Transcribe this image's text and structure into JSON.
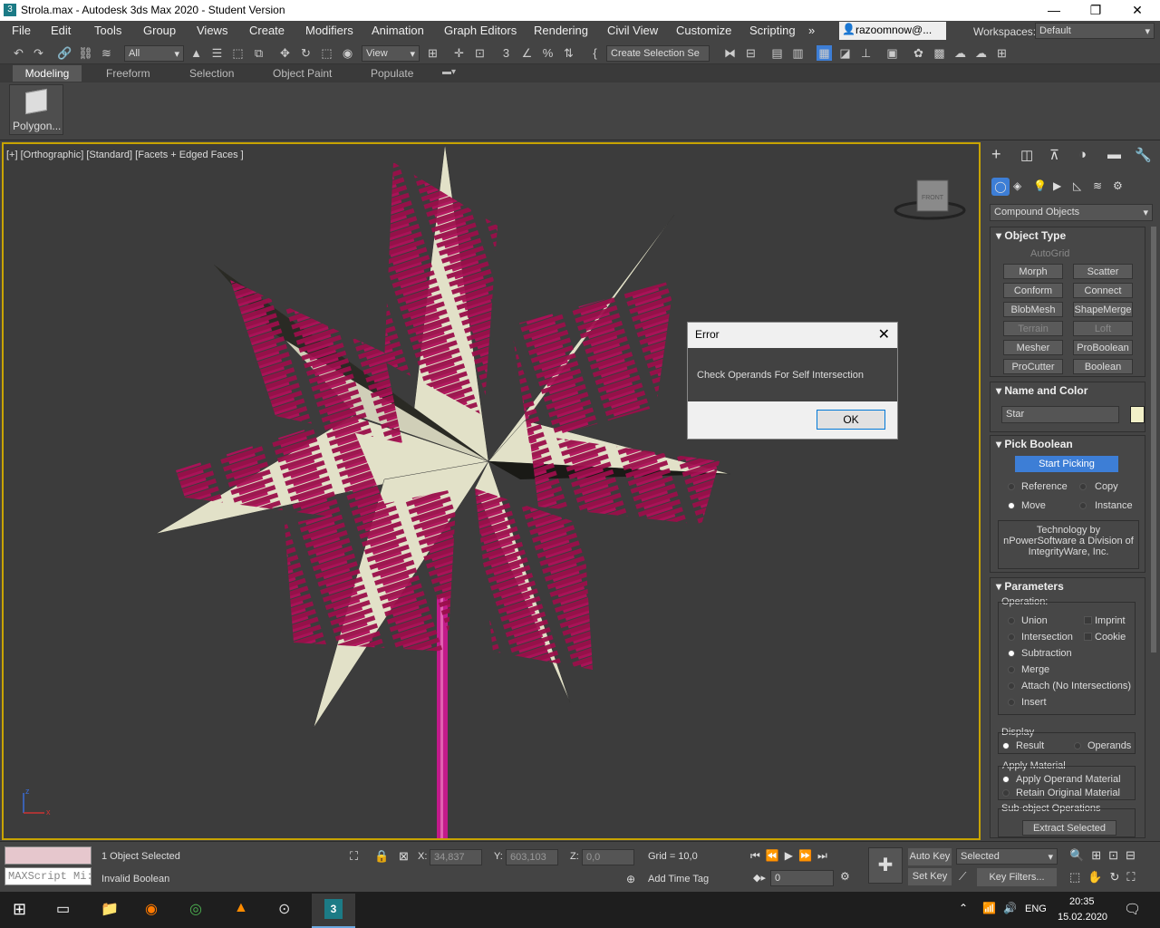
{
  "window": {
    "title": "Strola.max - Autodesk 3ds Max 2020 - Student Version",
    "minimize": "—",
    "maximize": "❐",
    "close": "✕"
  },
  "menu": [
    "File",
    "Edit",
    "Tools",
    "Group",
    "Views",
    "Create",
    "Modifiers",
    "Animation",
    "Graph Editors",
    "Rendering",
    "Civil View",
    "Customize",
    "Scripting"
  ],
  "menu_more": "»",
  "user": "razoomnow@...",
  "workspaces": {
    "label": "Workspaces:",
    "value": "Default"
  },
  "toolbar": {
    "filter": "All",
    "refcoord": "View",
    "selection_set": "Create Selection Se"
  },
  "ribbon": {
    "tabs": [
      "Modeling",
      "Freeform",
      "Selection",
      "Object Paint",
      "Populate"
    ],
    "button": "Polygon..."
  },
  "viewport": {
    "label": "[+] [Orthographic] [Standard] [Facets + Edged Faces ]",
    "viewcube": "FRONT",
    "axis_z": "z",
    "axis_x": "x"
  },
  "panel": {
    "category": "Compound Objects",
    "object_type": {
      "title": "Object Type",
      "autogrid": "AutoGrid",
      "buttons": [
        [
          "Morph",
          "Scatter"
        ],
        [
          "Conform",
          "Connect"
        ],
        [
          "BlobMesh",
          "ShapeMerge"
        ],
        [
          "Terrain",
          "Loft"
        ],
        [
          "Mesher",
          "ProBoolean"
        ],
        [
          "ProCutter",
          "Boolean"
        ]
      ]
    },
    "name_color": {
      "title": "Name and Color",
      "name": "Star",
      "color": "#f2f0c8"
    },
    "pick_boolean": {
      "title": "Pick Boolean",
      "start": "Start Picking",
      "options": [
        "Reference",
        "Copy",
        "Move",
        "Instance"
      ],
      "selected": "Move",
      "credit": "Technology by nPowerSoftware a Division of IntegrityWare, Inc."
    },
    "parameters": {
      "title": "Parameters",
      "operation_label": "Operation:",
      "ops": [
        "Union",
        "Intersection",
        "Subtraction",
        "Merge",
        "Attach (No Intersections)",
        "Insert"
      ],
      "ops_right": [
        "Imprint",
        "Cookie"
      ],
      "selected": "Subtraction",
      "display_label": "Display",
      "display": [
        "Result",
        "Operands"
      ],
      "apply_material_label": "Apply Material",
      "apply_material": [
        "Apply Operand Material",
        "Retain Original Material"
      ],
      "subobj_label": "Sub-object Operations",
      "extract": "Extract Selected"
    }
  },
  "dialog": {
    "title": "Error",
    "close": "✕",
    "message": "Check Operands For Self Intersection",
    "ok": "OK"
  },
  "status": {
    "selected": "1 Object Selected",
    "prompt": "Invalid Boolean",
    "maxscript": "MAXScript Mi:",
    "x_label": "X:",
    "x": "34,837",
    "y_label": "Y:",
    "y": "603,103",
    "z_label": "Z:",
    "z": "0,0",
    "grid": "Grid = 10,0",
    "add_time_tag": "Add Time Tag",
    "auto_key": "Auto Key",
    "set_key": "Set Key",
    "key_mode": "Selected",
    "key_filters": "Key Filters...",
    "frame": "0"
  },
  "taskbar": {
    "time": "20:35",
    "date": "15.02.2020",
    "lang": "ENG"
  },
  "colors": {
    "star": "#e2e1c8",
    "spikes": "#9a0f4a",
    "pole": "#c21a8a",
    "viewport_border": "#c8a400",
    "accent": "#3d7ed6"
  }
}
